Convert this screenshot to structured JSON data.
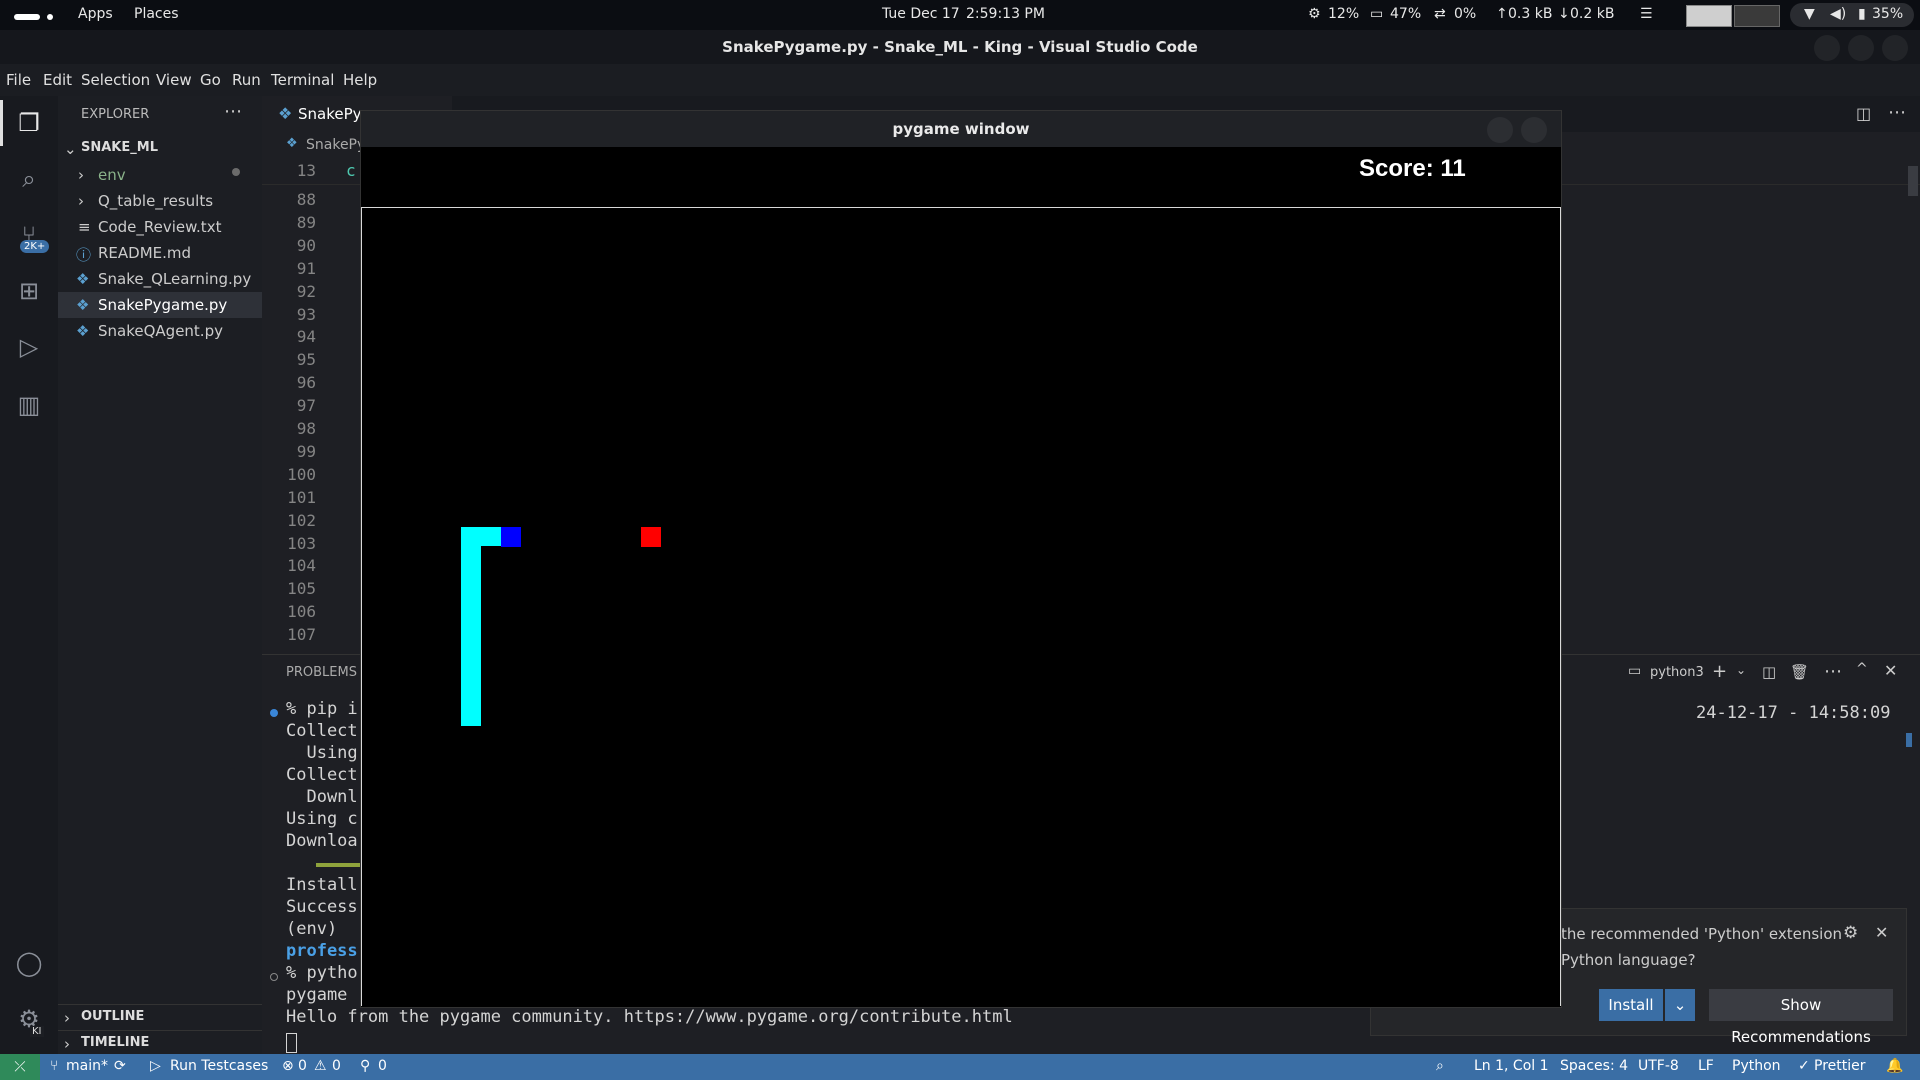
{
  "system": {
    "apps": "Apps",
    "places": "Places",
    "date": "Tue Dec 17",
    "time": "2:59:13 PM",
    "cpu": "12%",
    "mem": "47%",
    "swap": "0%",
    "net_up": "0.3 kB",
    "net_down": "0.2 kB",
    "battery": "35%"
  },
  "window": {
    "title": "SnakePygame.py - Snake_ML - King - Visual Studio Code"
  },
  "menu": [
    "File",
    "Edit",
    "Selection",
    "View",
    "Go",
    "Run",
    "Terminal",
    "Help"
  ],
  "activity": {
    "badge": "2K+",
    "settings_badge": "KI"
  },
  "explorer": {
    "header": "EXPLORER",
    "root": "SNAKE_ML",
    "items": [
      {
        "label": "env",
        "kind": "folder"
      },
      {
        "label": "Q_table_results",
        "kind": "folder"
      },
      {
        "label": "Code_Review.txt",
        "kind": "text"
      },
      {
        "label": "README.md",
        "kind": "info"
      },
      {
        "label": "Snake_QLearning.py",
        "kind": "python"
      },
      {
        "label": "SnakePygame.py",
        "kind": "python",
        "selected": true
      },
      {
        "label": "SnakeQAgent.py",
        "kind": "python"
      }
    ],
    "outline": "OUTLINE",
    "timeline": "TIMELINE"
  },
  "editor": {
    "tab": "SnakePy",
    "breadcrumb": "SnakePy",
    "sticky_line": "13",
    "sticky_code": "c",
    "line_numbers": [
      "88",
      "89",
      "90",
      "91",
      "92",
      "93",
      "94",
      "95",
      "96",
      "97",
      "98",
      "99",
      "100",
      "101",
      "102",
      "103",
      "104",
      "105",
      "106",
      "107"
    ]
  },
  "panel": {
    "problems_tab": "PROBLEMS",
    "shell": "python3",
    "timestamp": "24-12-17 - 14:58:09",
    "lines": [
      "% pip i",
      "Collect",
      "  Using",
      "Collect",
      "  Downl",
      "Using c",
      "Downloa",
      "",
      "Install",
      "Success",
      "(env)",
      "profess",
      "% pytho",
      "pygame ",
      "Hello from the pygame community. https://www.pygame.org/contribute.html"
    ]
  },
  "pygame": {
    "title": "pygame window",
    "score": "Score: 11"
  },
  "notification": {
    "line1": "the recommended 'Python' extension",
    "line2": "Python language?",
    "install": "Install",
    "show": "Show Recommendations"
  },
  "status": {
    "branch": "main*",
    "run": "Run Testcases",
    "errors": "0",
    "warnings": "0",
    "ports": "0",
    "position": "Ln 1, Col 1",
    "spaces": "Spaces: 4",
    "encoding": "UTF-8",
    "eol": "LF",
    "language": "Python",
    "prettier": "Prettier"
  },
  "colors": {
    "snake_body": "#00ffff",
    "snake_head": "#0000ff",
    "food": "#ff0000",
    "accent": "#3a6ea5"
  }
}
